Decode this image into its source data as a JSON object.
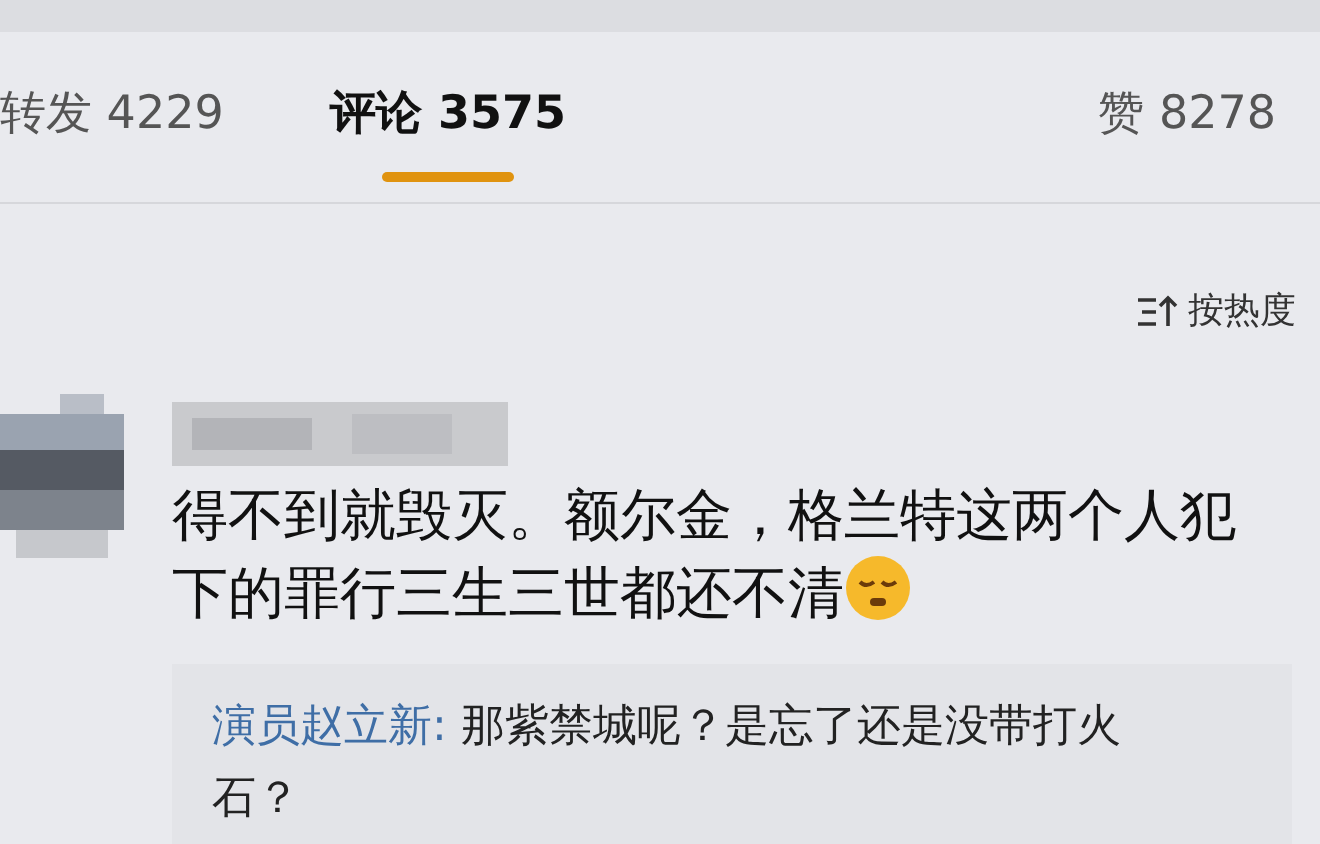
{
  "tabs": [
    {
      "label": "转发 4229",
      "selected": false
    },
    {
      "label": "评论 3575",
      "selected": true
    },
    {
      "label": "赞 8278",
      "selected": false
    }
  ],
  "sort": {
    "label": "按热度"
  },
  "comment": {
    "text": "得不到就毁灭。额尔金，格兰特这两个人犯下的罪行三生三世都还不清",
    "reply": {
      "author": "演员赵立新:",
      "text": " 那紫禁城呢？是忘了还是没带打火石？"
    }
  }
}
